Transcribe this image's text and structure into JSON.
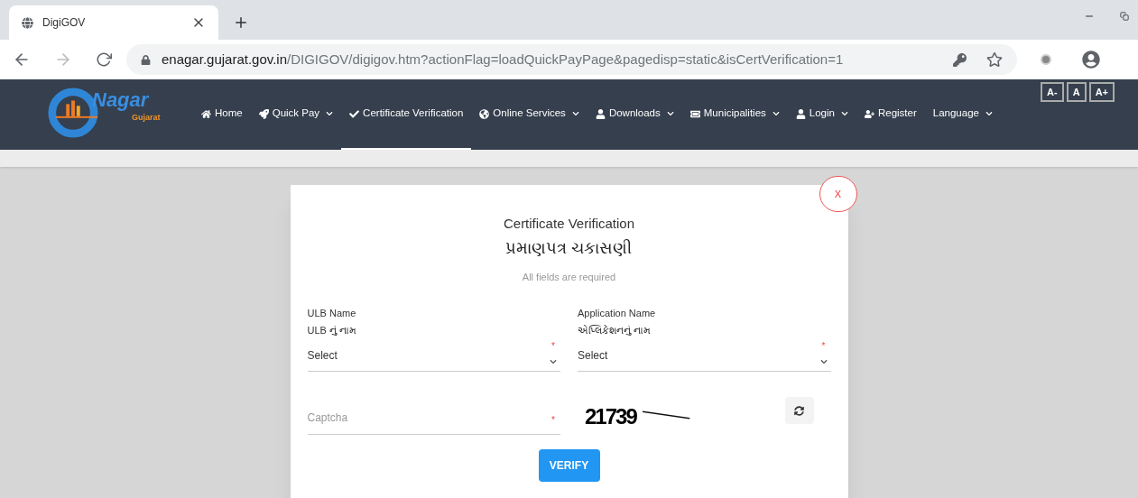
{
  "browser": {
    "tab_title": "DigiGOV",
    "url_host": "enagar.gujarat.gov.in",
    "url_path": "/DIGIGOV/digigov.htm?actionFlag=loadQuickPayPage&pagedisp=static&isCertVerification=1"
  },
  "logo": {
    "title": "Nagar",
    "subtitle": "Gujarat"
  },
  "nav": [
    {
      "label": "Home",
      "dropdown": false,
      "selected": false
    },
    {
      "label": "Quick Pay",
      "dropdown": true,
      "selected": false
    },
    {
      "label": "Certificate Verification",
      "dropdown": false,
      "selected": true
    },
    {
      "label": "Online Services",
      "dropdown": true,
      "selected": false
    },
    {
      "label": "Downloads",
      "dropdown": true,
      "selected": false
    },
    {
      "label": "Municipalities",
      "dropdown": true,
      "selected": false
    },
    {
      "label": "Login",
      "dropdown": true,
      "selected": false
    },
    {
      "label": "Register",
      "dropdown": false,
      "selected": false
    },
    {
      "label": "Language",
      "dropdown": true,
      "selected": false
    }
  ],
  "font_size_buttons": [
    "A-",
    "A",
    "A+"
  ],
  "modal": {
    "close": "X",
    "title": "Certificate Verification",
    "title_gu": "પ્રમાણપત્ર ચકાસણી",
    "note": "All fields are required",
    "selects": [
      {
        "label": "ULB Name",
        "label_gu": "ULB નું નામ",
        "value": "Select",
        "required_mark": "*"
      },
      {
        "label": "Application Name",
        "label_gu": "એપ્લિકેશનનું નામ",
        "value": "Select",
        "required_mark": "*"
      }
    ],
    "captcha": {
      "placeholder": "Captcha",
      "required_mark": "*",
      "code": "21739"
    },
    "submit": "VERIFY"
  }
}
